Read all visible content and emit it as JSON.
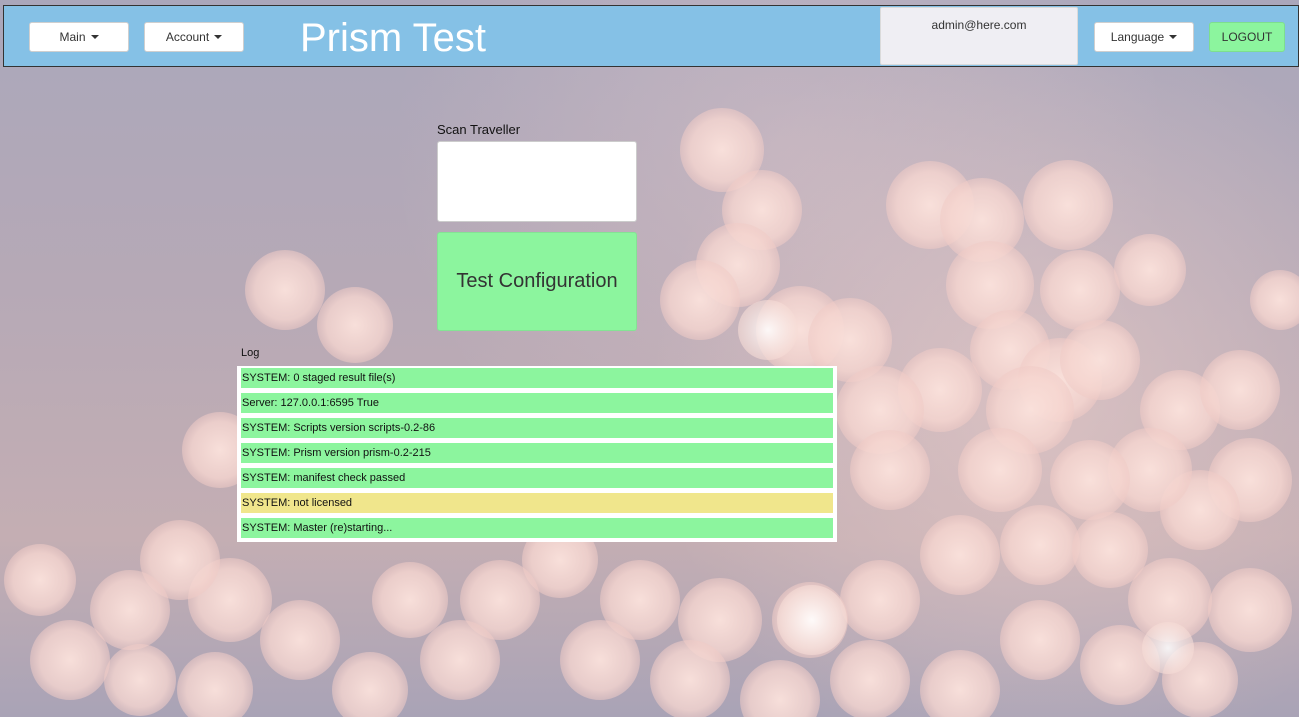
{
  "header": {
    "menus": [
      {
        "label": "Main"
      },
      {
        "label": "Account"
      }
    ],
    "brand": "Prism Test",
    "user_email": "admin@here.com",
    "language_label": "Language",
    "logout_label": "LOGOUT",
    "color": "#85c1e6"
  },
  "scan": {
    "label": "Scan Traveller",
    "value": ""
  },
  "test_button": {
    "label": "Test Configuration",
    "color": "#8cf59e"
  },
  "log": {
    "label": "Log",
    "entries": [
      {
        "text": "SYSTEM: 0 staged result file(s)",
        "level": "ok",
        "color": "#8cf59e"
      },
      {
        "text": "Server: 127.0.0.1:6595 True",
        "level": "ok",
        "color": "#8cf59e"
      },
      {
        "text": "SYSTEM: Scripts version scripts-0.2-86",
        "level": "ok",
        "color": "#8cf59e"
      },
      {
        "text": "SYSTEM: Prism version prism-0.2-215",
        "level": "ok",
        "color": "#8cf59e"
      },
      {
        "text": "SYSTEM: manifest check passed",
        "level": "ok",
        "color": "#8cf59e"
      },
      {
        "text": "SYSTEM: not licensed",
        "level": "warning",
        "color": "#f0e68c"
      },
      {
        "text": "SYSTEM: Master (re)starting...",
        "level": "ok",
        "color": "#8cf59e"
      }
    ]
  }
}
